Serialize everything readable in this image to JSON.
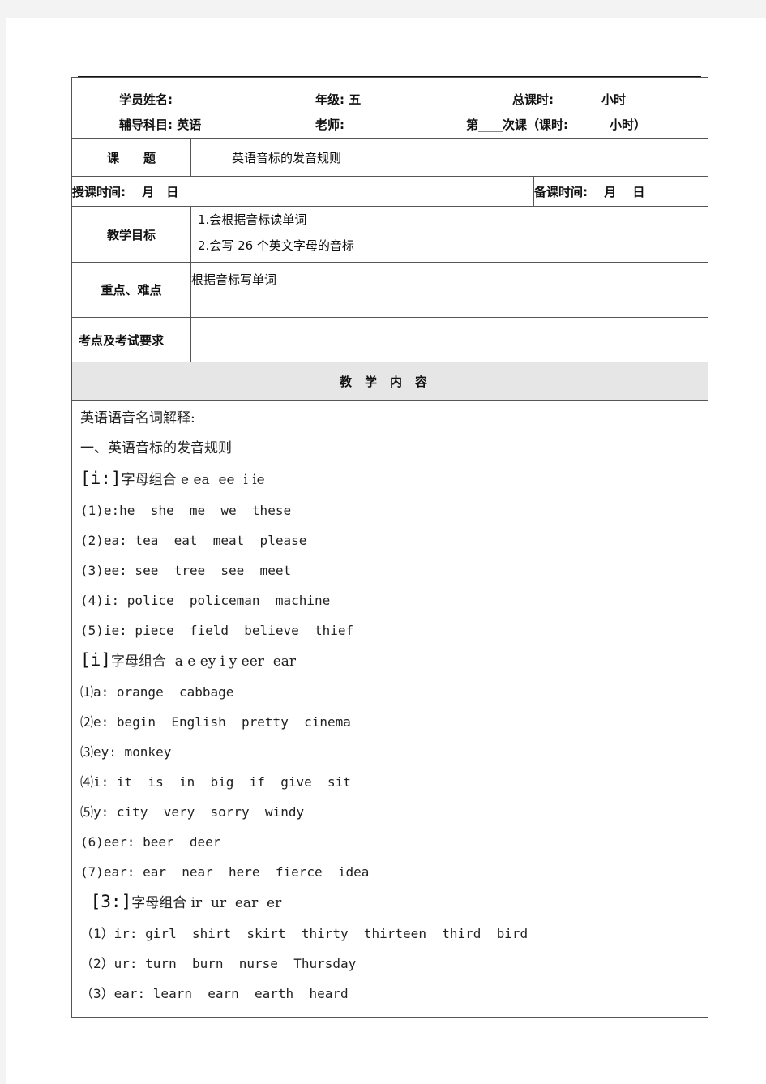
{
  "header": {
    "student_name_label": "学员姓名:",
    "grade_label": "年级: 五",
    "total_hours_label": "总课时:",
    "total_hours_unit": "小时",
    "subject_label": "辅导科目: 英语",
    "teacher_label": "老师:",
    "lesson_no_label": "第____次课（课时:",
    "lesson_hours_unit": "小时）"
  },
  "topic": {
    "label": "课　　题",
    "value": "英语音标的发音规则"
  },
  "times": {
    "teach_time": "授课时间:　 月　日",
    "prep_time": "备课时间:　 月　 日"
  },
  "goals": {
    "label": "教学目标",
    "items": [
      "1.会根据音标读单词",
      "2.会写 26 个英文字母的音标"
    ]
  },
  "key_points": {
    "label": "重点、难点",
    "value": "根据音标写单词"
  },
  "exam": {
    "label": "考点及考试要求",
    "value": ""
  },
  "content": {
    "header": "教学内容",
    "intro": "英语语音名词解释:",
    "section_title": "一、英语音标的发音规则",
    "groups": [
      {
        "symbol": "[i:]",
        "title": "字母组合 e ea  ee  i ie",
        "lines": [
          "(1)e:he  she  me  we  these",
          "(2)ea: tea  eat  meat  please",
          "(3)ee: see  tree  see  meet",
          "(4)i: police  policeman  machine",
          "(5)ie: piece  field  believe  thief"
        ]
      },
      {
        "symbol": "[i]",
        "title": "字母组合  a e ey i y eer  ear",
        "lines": [
          "⑴a: orange  cabbage",
          "⑵e: begin  English  pretty  cinema",
          "⑶ey: monkey",
          "⑷i: it  is  in  big  if  give  sit",
          "⑸y: city  very  sorry  windy",
          "(6)eer: beer  deer",
          "(7)ear: ear  near  here  fierce  idea"
        ]
      },
      {
        "symbol": " [3:]",
        "title": "字母组合 ir  ur  ear  er",
        "lines": [
          "（1）ir: girl  shirt  skirt  thirty  thirteen  third  bird",
          "（2）ur: turn  burn  nurse  Thursday",
          "（3）ear: learn  earn  earth  heard"
        ]
      }
    ]
  }
}
